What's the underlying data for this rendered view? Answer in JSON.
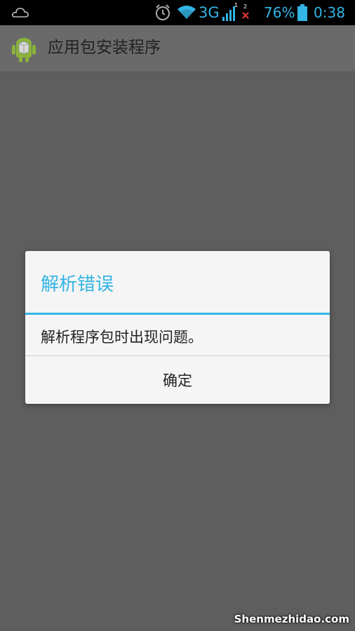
{
  "status_bar": {
    "network": "3G",
    "sim1": "1",
    "sim2": "2",
    "battery": "76%",
    "time": "0:38",
    "accent": "#33b5e5",
    "icons": [
      "cloud-icon",
      "alarm-icon",
      "wifi-icon",
      "signal-icon",
      "no-signal-icon",
      "battery-icon"
    ]
  },
  "action_bar": {
    "title": "应用包安装程序",
    "icon": "android-package-icon"
  },
  "dialog": {
    "title": "解析错误",
    "message": "解析程序包时出现问题。",
    "ok_label": "确定",
    "accent": "#33b5e5"
  },
  "watermark": "Shenmezhidao.com"
}
